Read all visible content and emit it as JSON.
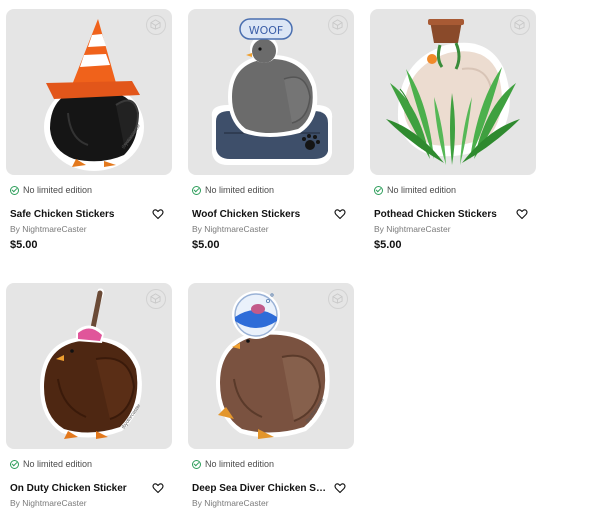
{
  "products": [
    {
      "title": "Safe Chicken Stickers",
      "seller": "By NightmareCaster",
      "price": "$5.00",
      "edition": "No limited edition",
      "art": "traffic-cone-chicken-icon"
    },
    {
      "title": "Woof Chicken Stickers",
      "seller": "By NightmareCaster",
      "price": "$5.00",
      "edition": "No limited edition",
      "art": "dog-bed-chicken-icon",
      "bubble_text": "WOOF"
    },
    {
      "title": "Pothead Chicken Stickers",
      "seller": "By NightmareCaster",
      "price": "$5.00",
      "edition": "No limited edition",
      "art": "plant-pot-chicken-icon"
    },
    {
      "title": "On Duty Chicken Sticker",
      "seller": "By NightmareCaster",
      "edition": "No limited edition",
      "art": "plunger-chicken-icon"
    },
    {
      "title": "Deep Sea Diver Chicken Sticker",
      "seller": "By NightmareCaster",
      "edition": "No limited edition",
      "art": "diver-chicken-icon"
    }
  ],
  "icons": {
    "ar_badge": "ar-view-icon",
    "edition": "check-circle-icon",
    "favorite": "heart-outline-icon"
  },
  "colors": {
    "card_background": "#e5e5e5",
    "check_green": "#2e9e5b",
    "text_primary": "#111111",
    "text_secondary": "#7a7a7a"
  }
}
